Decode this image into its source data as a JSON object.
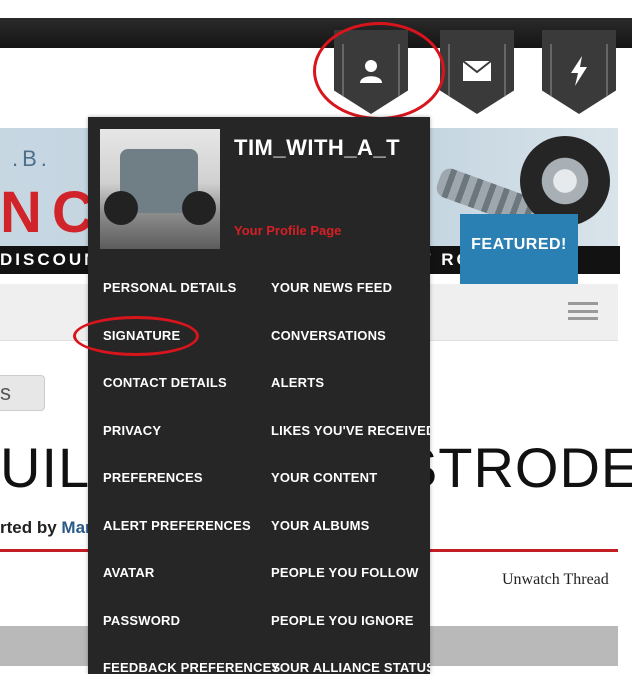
{
  "header": {
    "icons": [
      {
        "name": "user-icon"
      },
      {
        "name": "mail-icon"
      },
      {
        "name": "bolt-icon"
      }
    ]
  },
  "banner": {
    "brand_small": ".B.",
    "brand_big": "NCE",
    "tagline": "DISCOUNTS FROM YOUR FAVORITE HOT ROD V",
    "featured_label": "FEATURED!"
  },
  "page": {
    "tab_partial": "s",
    "thread_title": "UILD - MARTY STRODE",
    "byline_prefix": "rted by ",
    "byline_author": "Marty",
    "unwatch_label": "Unwatch Thread"
  },
  "menu": {
    "username": "TIM_WITH_A_T",
    "profile_link": "Your Profile Page",
    "left_column": [
      "PERSONAL DETAILS",
      "SIGNATURE",
      "CONTACT DETAILS",
      "PRIVACY",
      "PREFERENCES",
      "ALERT PREFERENCES",
      "AVATAR",
      "PASSWORD",
      "FEEDBACK PREFERENCES"
    ],
    "right_column": [
      "YOUR NEWS FEED",
      "CONVERSATIONS",
      "ALERTS",
      "LIKES YOU'VE RECEIVED",
      "YOUR CONTENT",
      "YOUR ALBUMS",
      "PEOPLE YOU FOLLOW",
      "PEOPLE YOU IGNORE",
      "YOUR ALLIANCE STATUS"
    ]
  },
  "colors": {
    "menu_bg": "#262626",
    "accent_red": "#d61f27",
    "featured_blue": "#2a7fb3"
  }
}
